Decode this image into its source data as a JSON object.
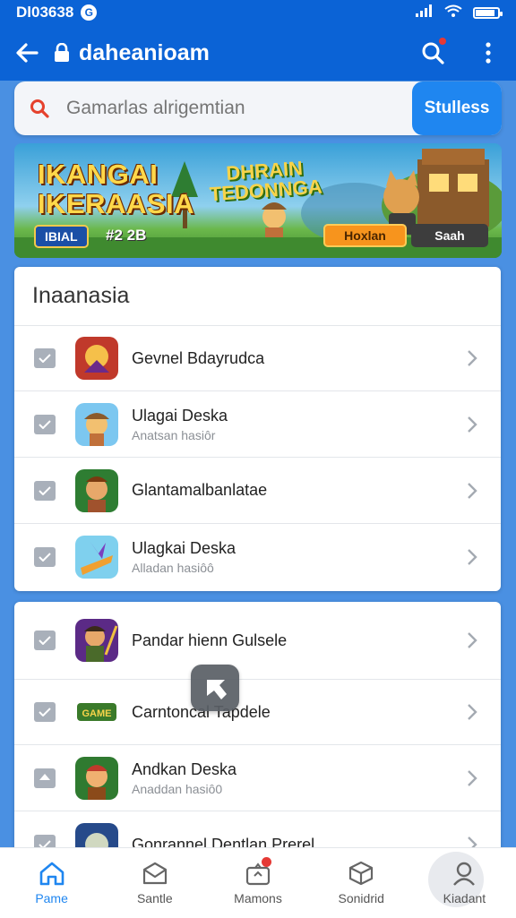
{
  "status_bar": {
    "time": "Dl03638",
    "badge": "G"
  },
  "app_bar": {
    "title": "daheanioam"
  },
  "search": {
    "placeholder": "Gamarlas alrigemtian",
    "button_label": "Stulless"
  },
  "banner": {
    "left_title_1": "IKANGAI",
    "left_title_2": "IKERAASIA",
    "center_title_1": "DHRAIN",
    "center_title_2": "TEDONNGA",
    "meta_left": "IBIAL",
    "meta_right": "#2 2B",
    "button_primary": "Hoxlan",
    "button_secondary": "Saah"
  },
  "section1": {
    "title": "Inaanasia",
    "items": [
      {
        "name": "Gevnel Bdayrudca",
        "sub": ""
      },
      {
        "name": "Ulagai Deska",
        "sub": "Anatsan hasiôr"
      },
      {
        "name": "Glantamalbanlatae",
        "sub": ""
      },
      {
        "name": "Ulagkai Deska",
        "sub": "Alladan hasiôô"
      }
    ]
  },
  "section2": {
    "items": [
      {
        "name": "Pandar hienn Gulsele",
        "sub": ""
      },
      {
        "name": "Carntoncal Tapdele",
        "sub": ""
      },
      {
        "name": "Andkan Deska",
        "sub": "Anaddan hasiô0"
      },
      {
        "name": "Gonrannel Dentlan Prerel",
        "sub": ""
      }
    ]
  },
  "bottom_nav": [
    {
      "label": "Pame",
      "icon": "home-icon"
    },
    {
      "label": "Santle",
      "icon": "mail-icon"
    },
    {
      "label": "Mamons",
      "icon": "gift-icon"
    },
    {
      "label": "Sonidrid",
      "icon": "box-icon"
    },
    {
      "label": "Kiadant",
      "icon": "profile-icon"
    }
  ],
  "colors": {
    "primary": "#0b63d6",
    "accent": "#1f86f0",
    "background": "#4a90e2",
    "badge": "#e53935"
  }
}
